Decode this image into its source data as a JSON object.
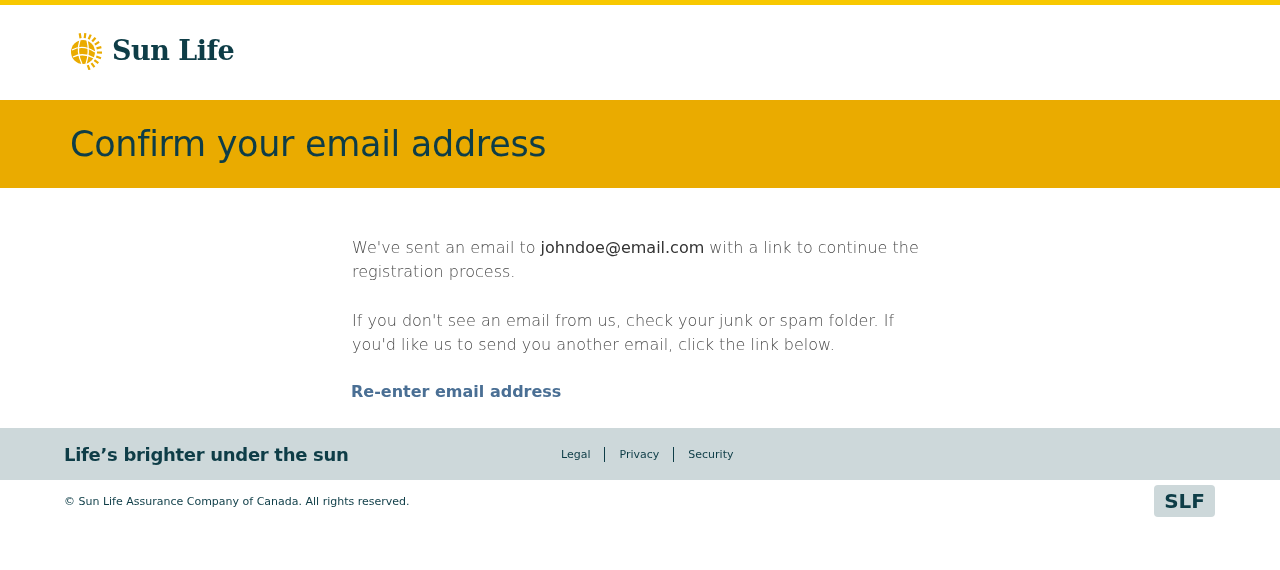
{
  "header": {
    "logo": "Sun Life"
  },
  "banner": {
    "title": "Confirm your email address"
  },
  "content": {
    "paragraphs": [
      "We've sent an email to **johndoe@email.com** with a link to continue the registration process.",
      "If you don't see an email from us, check your junk or spam folder. If you'd like us to send you another email, click the link below."
    ],
    "link": "Re-enter email address"
  },
  "footer": {
    "tagline": "Life’s brighter under the sun",
    "links": [
      "Legal",
      "Privacy",
      "Security"
    ],
    "copyright": "© Sun Life Assurance Company of Canada. All rights reserved.",
    "badge": "SLF"
  }
}
